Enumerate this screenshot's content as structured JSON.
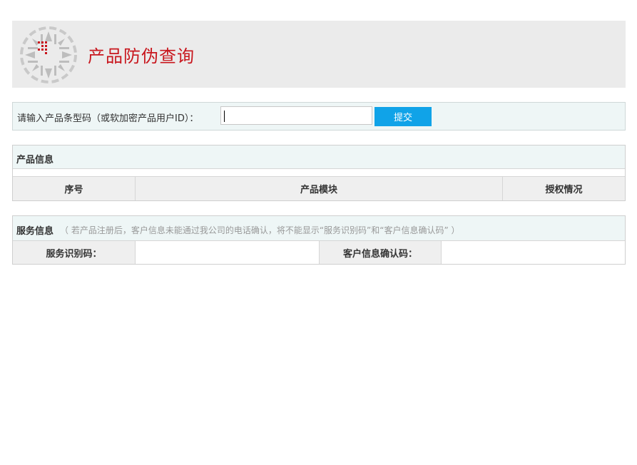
{
  "header": {
    "title": "产品防伪查询",
    "logo_icon": "company-seal-logo",
    "accent_color": "#c8161d",
    "background": "#ebebeb"
  },
  "query": {
    "label": "请输入产品条型码（或软加密产品用户ID）：",
    "input_value": "",
    "submit_label": "提交",
    "button_color": "#10a3e8"
  },
  "product_info": {
    "title": "产品信息",
    "columns": [
      "序号",
      "产品模块",
      "授权情况"
    ],
    "rows": []
  },
  "service_info": {
    "title": "服务信息",
    "note": "（ 若产品注册后，客户信息未能通过我公司的电话确认，将不能显示“服务识别码”和“客户信息确认码” ）",
    "service_code_label": "服务识别码：",
    "service_code_value": "",
    "confirm_code_label": "客户信息确认码：",
    "confirm_code_value": ""
  }
}
